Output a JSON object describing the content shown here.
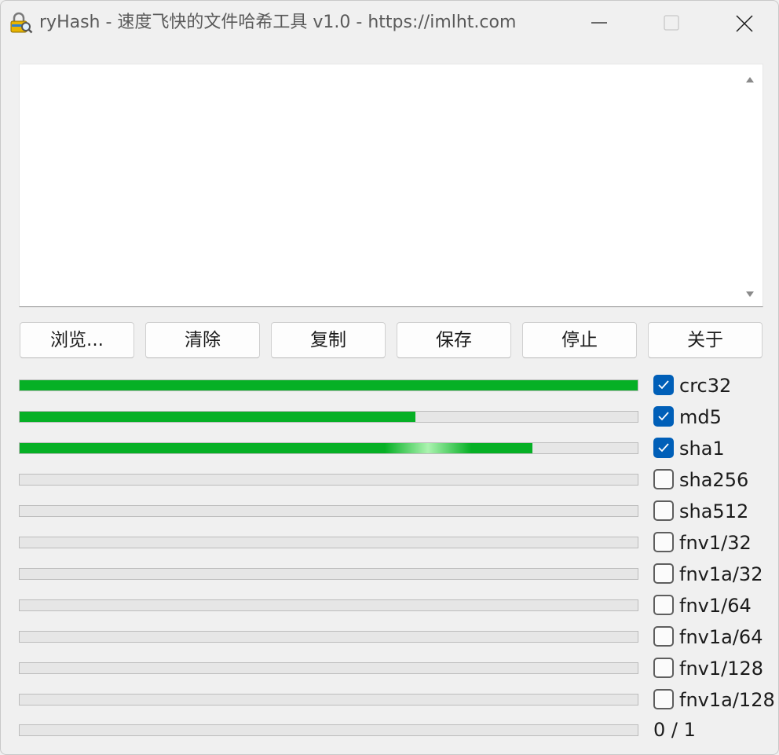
{
  "window": {
    "title": "ryHash - 速度飞快的文件哈希工具 v1.0 - https://imlht.com"
  },
  "output": {
    "text": ""
  },
  "buttons": {
    "browse": "浏览...",
    "clear": "清除",
    "copy": "复制",
    "save": "保存",
    "stop": "停止",
    "about": "关于"
  },
  "algorithms": [
    {
      "name": "crc32",
      "checked": true,
      "progress": 1.0
    },
    {
      "name": "md5",
      "checked": true,
      "progress": 0.64
    },
    {
      "name": "sha1",
      "checked": true,
      "progress": 0.83
    },
    {
      "name": "sha256",
      "checked": false,
      "progress": 0
    },
    {
      "name": "sha512",
      "checked": false,
      "progress": 0
    },
    {
      "name": "fnv1/32",
      "checked": false,
      "progress": 0
    },
    {
      "name": "fnv1a/32",
      "checked": false,
      "progress": 0
    },
    {
      "name": "fnv1/64",
      "checked": false,
      "progress": 0
    },
    {
      "name": "fnv1a/64",
      "checked": false,
      "progress": 0
    },
    {
      "name": "fnv1/128",
      "checked": false,
      "progress": 0
    },
    {
      "name": "fnv1a/128",
      "checked": false,
      "progress": 0
    }
  ],
  "total": {
    "count_text": "0 / 1",
    "progress": 0
  },
  "colors": {
    "progress_fill": "#06b025",
    "checkbox_checked": "#005fb8"
  },
  "icons": {
    "app": "lock-magnifier-icon",
    "minimize": "minimize-icon",
    "maximize": "maximize-icon",
    "close": "close-icon",
    "scroll_up": "scroll-up-arrow-icon",
    "scroll_down": "scroll-down-arrow-icon",
    "check": "checkmark-icon"
  }
}
